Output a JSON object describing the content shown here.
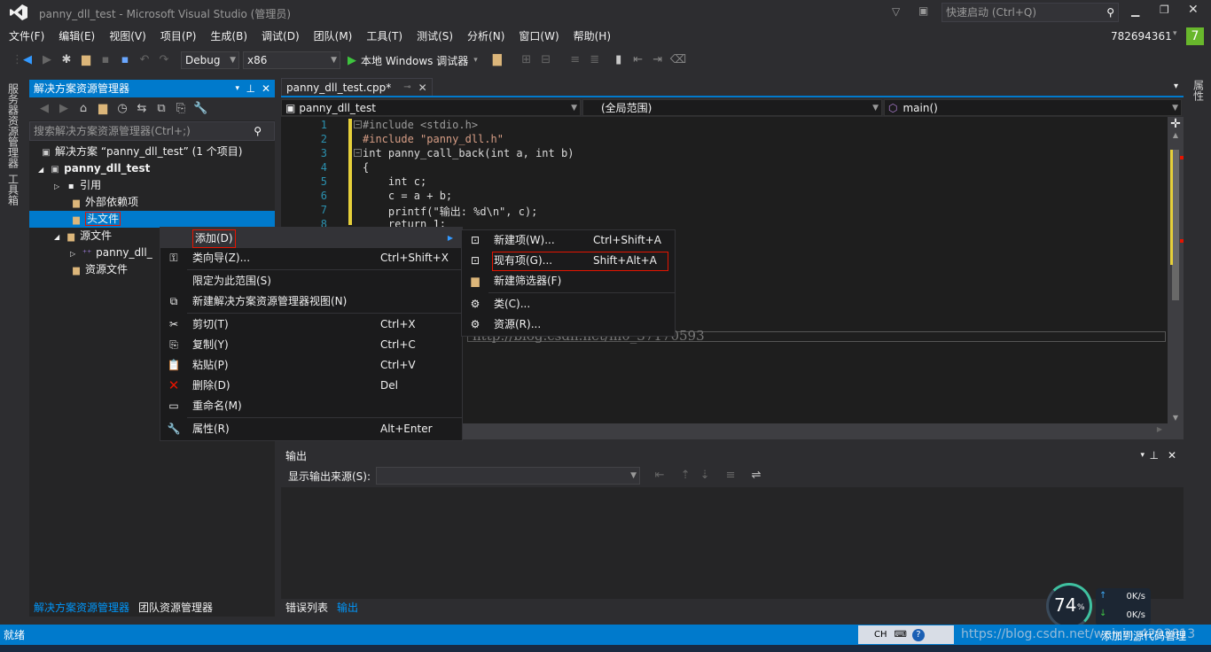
{
  "window": {
    "title": "panny_dll_test - Microsoft Visual Studio (管理员)",
    "quick_launch": "快速启动 (Ctrl+Q)",
    "user": "782694361",
    "notification_count": "7"
  },
  "menu": [
    "文件(F)",
    "编辑(E)",
    "视图(V)",
    "项目(P)",
    "生成(B)",
    "调试(D)",
    "团队(M)",
    "工具(T)",
    "测试(S)",
    "分析(N)",
    "窗口(W)",
    "帮助(H)"
  ],
  "toolbar": {
    "config": "Debug",
    "platform": "x86",
    "run_label": "本地 Windows 调试器"
  },
  "left_strip": {
    "server_explorer": "服务器资源管理器",
    "toolbox": "工具箱"
  },
  "right_strip": {
    "label": "属性"
  },
  "solution_explorer": {
    "title": "解决方案资源管理器",
    "search_placeholder": "搜索解决方案资源管理器(Ctrl+;)",
    "items": [
      {
        "label": "解决方案 “panny_dll_test” (1 个项目)"
      },
      {
        "label": "panny_dll_test"
      },
      {
        "label": "引用"
      },
      {
        "label": "外部依赖项"
      },
      {
        "label": "头文件"
      },
      {
        "label": "源文件"
      },
      {
        "label": "panny_dll_"
      },
      {
        "label": "资源文件"
      }
    ],
    "bottom_tabs": [
      "解决方案资源管理器",
      "团队资源管理器"
    ]
  },
  "editor": {
    "tab": "panny_dll_test.cpp*",
    "nav_project": "panny_dll_test",
    "nav_scope": "(全局范围)",
    "nav_member": "main()",
    "line_numbers": [
      "1",
      "2",
      "3",
      "4",
      "5",
      "6",
      "7",
      "8"
    ],
    "lines": [
      "#include <stdio.h>",
      "#include \"panny_dll.h\"",
      "int panny_call_back(int a, int b)",
      "{",
      "    int c;",
      "    c = a + b;",
      "    printf(\"输出: %d\\n\", c);",
      "    return 1;"
    ],
    "watermark": "http://blog.csdn.net/m0_37170593"
  },
  "context_menu": {
    "items": [
      {
        "label": "添加(D)",
        "shortcut": ""
      },
      {
        "label": "类向导(Z)...",
        "shortcut": "Ctrl+Shift+X"
      },
      {
        "label": "限定为此范围(S)",
        "shortcut": ""
      },
      {
        "label": "新建解决方案资源管理器视图(N)",
        "shortcut": ""
      },
      {
        "label": "剪切(T)",
        "shortcut": "Ctrl+X"
      },
      {
        "label": "复制(Y)",
        "shortcut": "Ctrl+C"
      },
      {
        "label": "粘贴(P)",
        "shortcut": "Ctrl+V"
      },
      {
        "label": "删除(D)",
        "shortcut": "Del"
      },
      {
        "label": "重命名(M)",
        "shortcut": ""
      },
      {
        "label": "属性(R)",
        "shortcut": "Alt+Enter"
      }
    ]
  },
  "submenu": {
    "items": [
      {
        "label": "新建项(W)...",
        "shortcut": "Ctrl+Shift+A"
      },
      {
        "label": "现有项(G)...",
        "shortcut": "Shift+Alt+A"
      },
      {
        "label": "新建筛选器(F)",
        "shortcut": ""
      },
      {
        "label": "类(C)...",
        "shortcut": ""
      },
      {
        "label": "资源(R)...",
        "shortcut": ""
      }
    ]
  },
  "output": {
    "title": "输出",
    "source_label": "显示输出来源(S):",
    "tabs": [
      "错误列表",
      "输出"
    ]
  },
  "status": {
    "left": "就绪",
    "ime": "CH",
    "right": "添加到源代码管理",
    "url_watermark": "https://blog.csdn.net/weixin_4293813"
  },
  "network": {
    "percent": "74",
    "unit": "%",
    "up": "0K/s",
    "down": "0K/s"
  },
  "colors": {
    "accent": "#007acc",
    "background": "#2d2d30",
    "editor_bg": "#1e1e1e",
    "highlight_box": "#e51400"
  }
}
